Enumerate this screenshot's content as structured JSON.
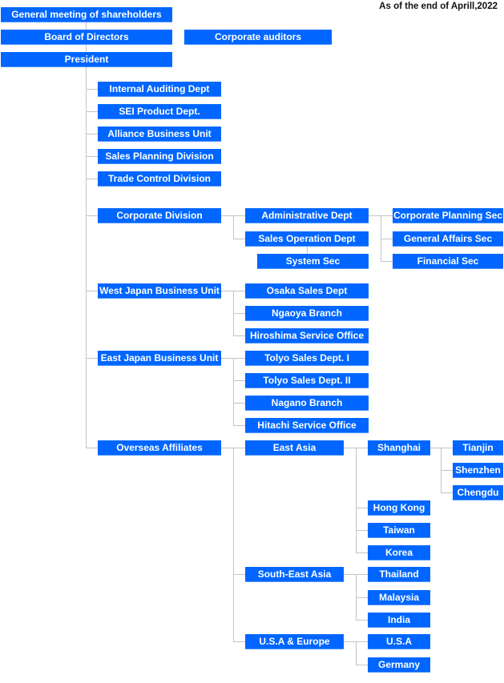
{
  "header": {
    "as_of": "As of the end of Aprill,2022"
  },
  "colors": {
    "box_fill": "#0066ff",
    "box_text": "#ffffff",
    "connector": "#c4c4c4"
  },
  "top": {
    "general_meeting": "General meeting of  shareholders",
    "board": "Board of Directors",
    "auditors": "Corporate auditors",
    "president": "President"
  },
  "staff": {
    "internal_auditing": "Internal Auditing Dept",
    "sei_product": "SEI Product Dept.",
    "alliance": "Alliance Business Unit",
    "sales_planning": "Sales Planning Division",
    "trade_control": "Trade Control Division"
  },
  "corporate": {
    "division": "Corporate Division",
    "admin": "Administrative Dept",
    "sales_operation": "Sales Operation Dept",
    "system_sec": "System Sec",
    "planning_sec": "Corporate Planning Sec",
    "general_affairs_sec": "General Affairs Sec",
    "financial_sec": "Financial Sec"
  },
  "west": {
    "unit": "West Japan Business Unit",
    "osaka": "Osaka Sales Dept",
    "ngaoya": "Ngaoya Branch",
    "hiroshima": "Hiroshima Service Office"
  },
  "east": {
    "unit": "East Japan Business Unit",
    "tolyo1": "Tolyo Sales Dept. I",
    "tolyo2": "Tolyo Sales Dept. II",
    "nagano": "Nagano Branch",
    "hitachi": "Hitachi Service Office"
  },
  "overseas": {
    "affiliates": "Overseas Affiliates",
    "east_asia": "East Asia",
    "shanghai": "Shanghai",
    "tianjin": "Tianjin",
    "shenzhen": "Shenzhen",
    "chengdu": "Chengdu",
    "hong_kong": "Hong Kong",
    "taiwan": "Taiwan",
    "korea": "Korea",
    "south_east_asia": "South-East Asia",
    "thailand": "Thailand",
    "malaysia": "Malaysia",
    "india": "India",
    "usa_europe": "U.S.A & Europe",
    "usa": "U.S.A",
    "germany": "Germany"
  }
}
